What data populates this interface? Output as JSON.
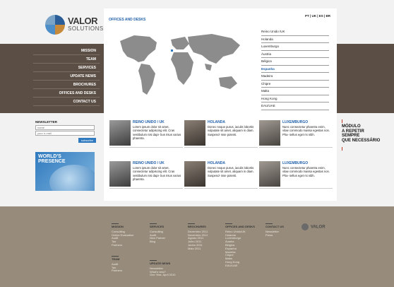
{
  "brand": {
    "name": "VALOR",
    "sub": "SOLUTIONS"
  },
  "nav": [
    "MISSION",
    "TEAM",
    "SERVICES",
    "UPDATE NEWS",
    "BROCHURES",
    "OFFICES AND DESKS",
    "CONTACT US"
  ],
  "newsletter": {
    "title": "NEWSLETTER",
    "name_placeholder": "name",
    "email_placeholder": "your e-mail",
    "subscribe": "subscribe"
  },
  "presence": {
    "line1": "WORLD'S",
    "line2": "PRESENCE"
  },
  "main": {
    "title": "OFFICES AND DESKS",
    "languages": "PT | UK | ES | BR"
  },
  "countries": [
    "Reino Unido /UK",
    "Holanda",
    "Luxemburgo",
    "Áustria",
    "Bélgica",
    "Espanha",
    "Madeira",
    "Chipre",
    "Malta",
    "Hong Kong",
    "EAU/UAE"
  ],
  "active_country": "Espanha",
  "cards": [
    {
      "title": "REINO UNIDO / UK",
      "body": "Lorem ipsum dolor sit amet, consectetur adipiscing elit. Cras vestibulum nisi dapi- bus risus varius pharetra."
    },
    {
      "title": "HOLANDA",
      "body": "Donec neque purus, iaculis lobortis vulputate sit amet, aliquam in diam. Suspend- isse potenti."
    },
    {
      "title": "LUXEMBURGO",
      "body": "Nunc consectetur pharetra enim, vitae commodo massa egestas non. Pha- sellus eget mi nibh."
    },
    {
      "title": "REINO UNIDO / UK",
      "body": "Lorem ipsum dolor sit amet, consectetur adipiscing elit. Cras vestibulum nisi dapi- bus risus varius pharetra."
    },
    {
      "title": "HOLANDA",
      "body": "Donec neque purus, iaculis lobortis vulputate sit amet, aliquam in diam. Suspend- isse potenti."
    },
    {
      "title": "LUXEMBURGO",
      "body": "Nunc consectetur pharetra enim, vitae commodo massa egestas non. Pha- sellus eget mi nibh."
    }
  ],
  "module": {
    "l1": "MÓDULO",
    "l2": "A REPETIR",
    "l3": "SEMPRE",
    "l4": "QUE NECESSÁRIO"
  },
  "footer": {
    "mission": {
      "h": "MISSION",
      "items": [
        "Consulting",
        "Online Evaluation",
        "Audit",
        "Tax",
        "Partners"
      ]
    },
    "team": {
      "h": "TEAM",
      "items": [
        "Audit",
        "Tax",
        "Partners"
      ]
    },
    "services": {
      "h": "SERVICES",
      "items": [
        "Consulting",
        "Audit",
        "New Partner",
        "Blog"
      ]
    },
    "update": {
      "h": "UPDATE NEWS",
      "items": [
        "Newsletter",
        "What's new?",
        "One Year, April 2010"
      ]
    },
    "brochures": {
      "h": "BROCHURES",
      "items": [
        "Dezembro 2011",
        "Novembro 2011",
        "Agosto 2011",
        "Julho 2011",
        "Junho 2011",
        "Maio 2011"
      ]
    },
    "offices": {
      "h": "OFFICES AND DESKS",
      "items": [
        "Reino Unido/UK",
        "Holanda",
        "Luxemburgo",
        "Áustria",
        "Bélgica",
        "Espanha",
        "Madeira",
        "Chipre",
        "Malta",
        "Hong Kong",
        "EAU/UAE"
      ]
    },
    "contact": {
      "h": "CONTACT US",
      "items": [
        "Newsletter",
        "Press"
      ]
    },
    "logo": "VALOR"
  },
  "colors": {
    "band": "#5b4f45",
    "footer": "#978c7b",
    "accent": "#1f5fa8",
    "subscribe": "#2f7abf"
  }
}
